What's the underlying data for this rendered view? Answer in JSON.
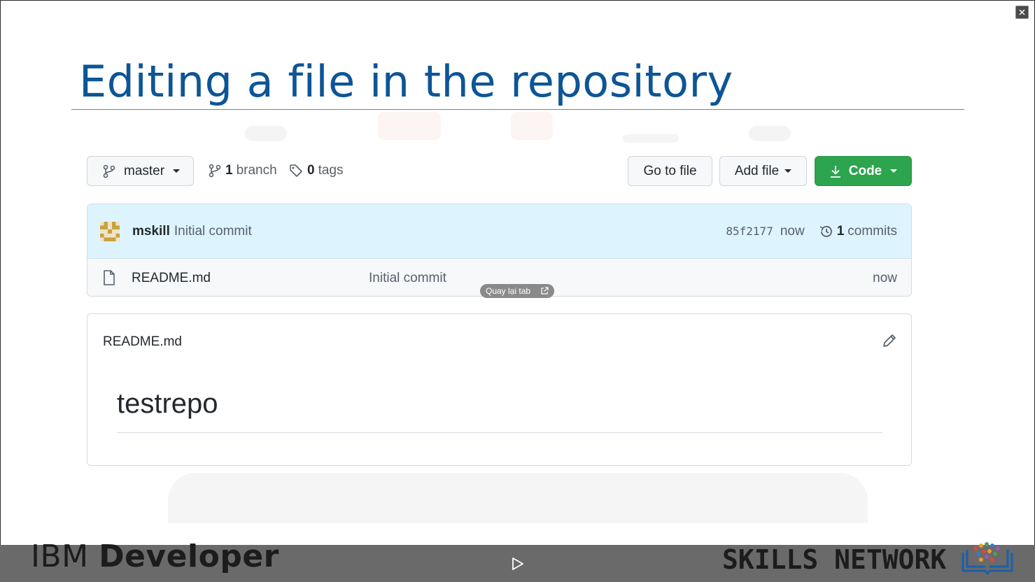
{
  "slide": {
    "title": "Editing a file in the repository"
  },
  "toolbar": {
    "branch_button": "master",
    "branch_count": "1",
    "branch_label": "branch",
    "tag_count": "0",
    "tag_label": "tags",
    "go_to_file": "Go to file",
    "add_file": "Add file",
    "code": "Code"
  },
  "commit": {
    "user": "mskill",
    "message": "Initial commit",
    "sha": "85f2177",
    "time": "now",
    "commits_count": "1",
    "commits_label": "commits"
  },
  "files": [
    {
      "name": "README.md",
      "commit_message": "Initial commit",
      "time": "now"
    }
  ],
  "overlay": {
    "back_to_tab": "Quay lại tab"
  },
  "readme": {
    "filename": "README.md",
    "heading": "testrepo"
  },
  "footer": {
    "ibm": "IBM",
    "developer": "Developer",
    "skills_network": "SKILLS NETWORK"
  },
  "colors": {
    "title": "#0d5596",
    "code_button": "#2da44e",
    "commit_row": "#ddf4ff",
    "footer_bar": "#6a6a6a"
  },
  "icons": [
    "close-icon",
    "git-branch-icon",
    "tag-icon",
    "download-icon",
    "history-icon",
    "file-icon",
    "pencil-icon",
    "external-link-icon",
    "play-icon",
    "identicon-avatar"
  ]
}
